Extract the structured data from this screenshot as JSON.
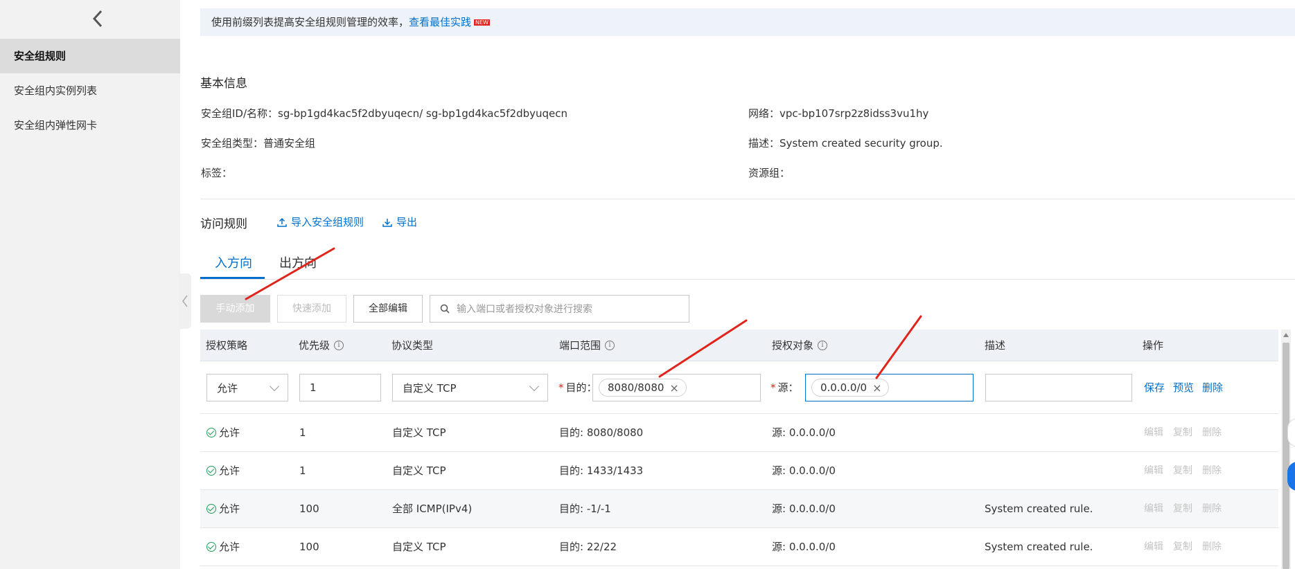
{
  "sidebar": {
    "items": [
      {
        "label": "安全组规则",
        "active": true
      },
      {
        "label": "安全组内实例列表",
        "active": false
      },
      {
        "label": "安全组内弹性网卡",
        "active": false
      }
    ]
  },
  "banner": {
    "text": "使用前缀列表提高安全组规则管理的效率，",
    "link": "查看最佳实践",
    "badge": "NEW"
  },
  "basic_info": {
    "title": "基本信息",
    "id_label": "安全组ID/名称：",
    "id_value": "sg-bp1gd4kac5f2dbyuqecn/ sg-bp1gd4kac5f2dbyuqecn",
    "network_label": "网络：",
    "network_value": "vpc-bp107srp2z8idss3vu1hy",
    "type_label": "安全组类型：",
    "type_value": "普通安全组",
    "desc_label": "描述：",
    "desc_value": "System created security group.",
    "tags_label": "标签：",
    "resgroup_label": "资源组："
  },
  "rules": {
    "title": "访问规则",
    "import_label": "导入安全组规则",
    "export_label": "导出"
  },
  "tabs": [
    {
      "label": "入方向",
      "active": true
    },
    {
      "label": "出方向",
      "active": false
    }
  ],
  "toolbar": {
    "manual_add": "手动添加",
    "quick_add": "快速添加",
    "edit_all": "全部编辑",
    "search_placeholder": "输入端口或者授权对象进行搜索"
  },
  "table": {
    "headers": {
      "policy": "授权策略",
      "priority": "优先级",
      "protocol": "协议类型",
      "port": "端口范围",
      "target": "授权对象",
      "desc": "描述",
      "ops": "操作"
    },
    "edit_row": {
      "policy": "允许",
      "priority": "1",
      "protocol": "自定义 TCP",
      "port_label": "目的：",
      "port_tag": "8080/8080",
      "source_label": "源：",
      "source_tag": "0.0.0.0/0",
      "desc": "",
      "save": "保存",
      "preview": "预览",
      "delete": "删除"
    },
    "rows": [
      {
        "policy": "允许",
        "priority": "1",
        "protocol": "自定义 TCP",
        "port": "目的: 8080/8080",
        "target": "源: 0.0.0.0/0",
        "desc": "",
        "edit": "编辑",
        "copy": "复制",
        "delete": "删除"
      },
      {
        "policy": "允许",
        "priority": "1",
        "protocol": "自定义 TCP",
        "port": "目的: 1433/1433",
        "target": "源: 0.0.0.0/0",
        "desc": "",
        "edit": "编辑",
        "copy": "复制",
        "delete": "删除"
      },
      {
        "policy": "允许",
        "priority": "100",
        "protocol": "全部 ICMP(IPv4)",
        "port": "目的: -1/-1",
        "target": "源: 0.0.0.0/0",
        "desc": "System created rule.",
        "edit": "编辑",
        "copy": "复制",
        "delete": "删除"
      },
      {
        "policy": "允许",
        "priority": "100",
        "protocol": "自定义 TCP",
        "port": "目的: 22/22",
        "target": "源: 0.0.0.0/0",
        "desc": "System created rule.",
        "edit": "编辑",
        "copy": "复制",
        "delete": "删除"
      }
    ]
  },
  "colors": {
    "accent": "#0070cc",
    "annotation": "#e0241b",
    "sidebar_bg": "#f2f2f2"
  }
}
